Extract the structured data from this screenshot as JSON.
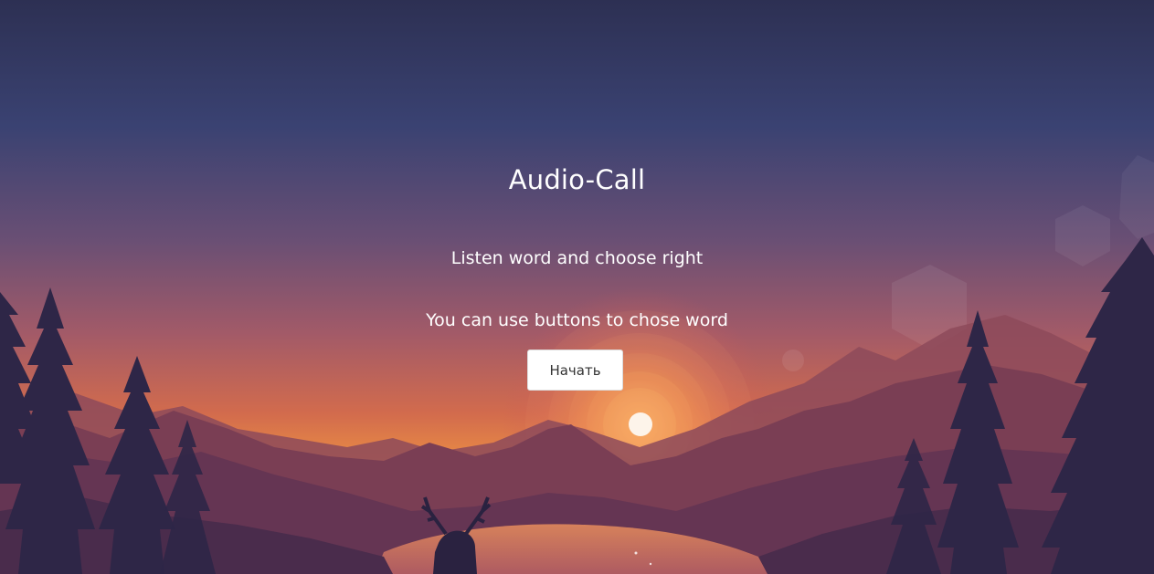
{
  "main": {
    "title": "Audio-Call",
    "subtitle": "Listen word and choose right",
    "hint": "You can use buttons to chose word",
    "start_label": "Начать"
  },
  "background": {
    "scene": "sunset-mountain-lake-forest-deer",
    "colors": {
      "sky_top": "#2e3157",
      "sky_mid": "#70506f",
      "horizon": "#e5743f",
      "sun": "#fff6ee",
      "mountains": "#6e3b4e",
      "trees": "#2b2445"
    }
  }
}
